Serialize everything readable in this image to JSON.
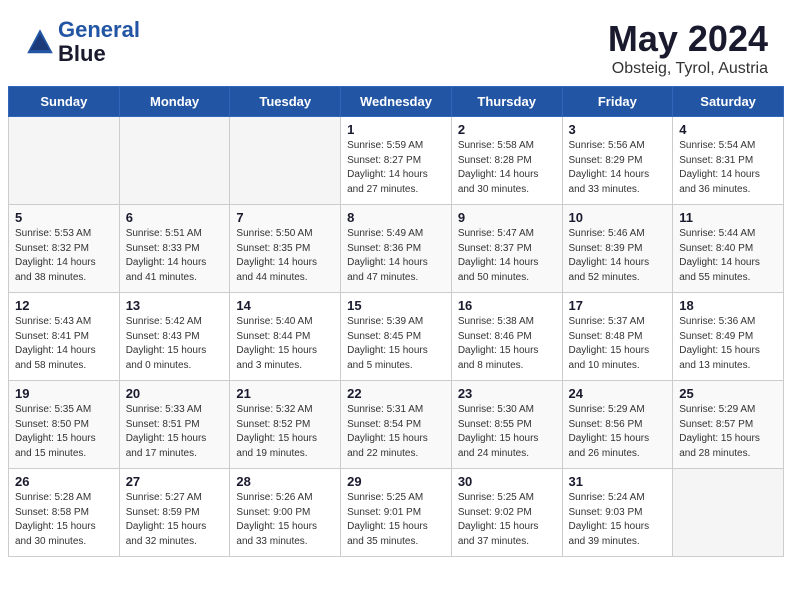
{
  "header": {
    "logo_line1": "General",
    "logo_line2": "Blue",
    "month": "May 2024",
    "location": "Obsteig, Tyrol, Austria"
  },
  "weekdays": [
    "Sunday",
    "Monday",
    "Tuesday",
    "Wednesday",
    "Thursday",
    "Friday",
    "Saturday"
  ],
  "weeks": [
    [
      {
        "day": "",
        "info": ""
      },
      {
        "day": "",
        "info": ""
      },
      {
        "day": "",
        "info": ""
      },
      {
        "day": "1",
        "info": "Sunrise: 5:59 AM\nSunset: 8:27 PM\nDaylight: 14 hours\nand 27 minutes."
      },
      {
        "day": "2",
        "info": "Sunrise: 5:58 AM\nSunset: 8:28 PM\nDaylight: 14 hours\nand 30 minutes."
      },
      {
        "day": "3",
        "info": "Sunrise: 5:56 AM\nSunset: 8:29 PM\nDaylight: 14 hours\nand 33 minutes."
      },
      {
        "day": "4",
        "info": "Sunrise: 5:54 AM\nSunset: 8:31 PM\nDaylight: 14 hours\nand 36 minutes."
      }
    ],
    [
      {
        "day": "5",
        "info": "Sunrise: 5:53 AM\nSunset: 8:32 PM\nDaylight: 14 hours\nand 38 minutes."
      },
      {
        "day": "6",
        "info": "Sunrise: 5:51 AM\nSunset: 8:33 PM\nDaylight: 14 hours\nand 41 minutes."
      },
      {
        "day": "7",
        "info": "Sunrise: 5:50 AM\nSunset: 8:35 PM\nDaylight: 14 hours\nand 44 minutes."
      },
      {
        "day": "8",
        "info": "Sunrise: 5:49 AM\nSunset: 8:36 PM\nDaylight: 14 hours\nand 47 minutes."
      },
      {
        "day": "9",
        "info": "Sunrise: 5:47 AM\nSunset: 8:37 PM\nDaylight: 14 hours\nand 50 minutes."
      },
      {
        "day": "10",
        "info": "Sunrise: 5:46 AM\nSunset: 8:39 PM\nDaylight: 14 hours\nand 52 minutes."
      },
      {
        "day": "11",
        "info": "Sunrise: 5:44 AM\nSunset: 8:40 PM\nDaylight: 14 hours\nand 55 minutes."
      }
    ],
    [
      {
        "day": "12",
        "info": "Sunrise: 5:43 AM\nSunset: 8:41 PM\nDaylight: 14 hours\nand 58 minutes."
      },
      {
        "day": "13",
        "info": "Sunrise: 5:42 AM\nSunset: 8:43 PM\nDaylight: 15 hours\nand 0 minutes."
      },
      {
        "day": "14",
        "info": "Sunrise: 5:40 AM\nSunset: 8:44 PM\nDaylight: 15 hours\nand 3 minutes."
      },
      {
        "day": "15",
        "info": "Sunrise: 5:39 AM\nSunset: 8:45 PM\nDaylight: 15 hours\nand 5 minutes."
      },
      {
        "day": "16",
        "info": "Sunrise: 5:38 AM\nSunset: 8:46 PM\nDaylight: 15 hours\nand 8 minutes."
      },
      {
        "day": "17",
        "info": "Sunrise: 5:37 AM\nSunset: 8:48 PM\nDaylight: 15 hours\nand 10 minutes."
      },
      {
        "day": "18",
        "info": "Sunrise: 5:36 AM\nSunset: 8:49 PM\nDaylight: 15 hours\nand 13 minutes."
      }
    ],
    [
      {
        "day": "19",
        "info": "Sunrise: 5:35 AM\nSunset: 8:50 PM\nDaylight: 15 hours\nand 15 minutes."
      },
      {
        "day": "20",
        "info": "Sunrise: 5:33 AM\nSunset: 8:51 PM\nDaylight: 15 hours\nand 17 minutes."
      },
      {
        "day": "21",
        "info": "Sunrise: 5:32 AM\nSunset: 8:52 PM\nDaylight: 15 hours\nand 19 minutes."
      },
      {
        "day": "22",
        "info": "Sunrise: 5:31 AM\nSunset: 8:54 PM\nDaylight: 15 hours\nand 22 minutes."
      },
      {
        "day": "23",
        "info": "Sunrise: 5:30 AM\nSunset: 8:55 PM\nDaylight: 15 hours\nand 24 minutes."
      },
      {
        "day": "24",
        "info": "Sunrise: 5:29 AM\nSunset: 8:56 PM\nDaylight: 15 hours\nand 26 minutes."
      },
      {
        "day": "25",
        "info": "Sunrise: 5:29 AM\nSunset: 8:57 PM\nDaylight: 15 hours\nand 28 minutes."
      }
    ],
    [
      {
        "day": "26",
        "info": "Sunrise: 5:28 AM\nSunset: 8:58 PM\nDaylight: 15 hours\nand 30 minutes."
      },
      {
        "day": "27",
        "info": "Sunrise: 5:27 AM\nSunset: 8:59 PM\nDaylight: 15 hours\nand 32 minutes."
      },
      {
        "day": "28",
        "info": "Sunrise: 5:26 AM\nSunset: 9:00 PM\nDaylight: 15 hours\nand 33 minutes."
      },
      {
        "day": "29",
        "info": "Sunrise: 5:25 AM\nSunset: 9:01 PM\nDaylight: 15 hours\nand 35 minutes."
      },
      {
        "day": "30",
        "info": "Sunrise: 5:25 AM\nSunset: 9:02 PM\nDaylight: 15 hours\nand 37 minutes."
      },
      {
        "day": "31",
        "info": "Sunrise: 5:24 AM\nSunset: 9:03 PM\nDaylight: 15 hours\nand 39 minutes."
      },
      {
        "day": "",
        "info": ""
      }
    ]
  ]
}
